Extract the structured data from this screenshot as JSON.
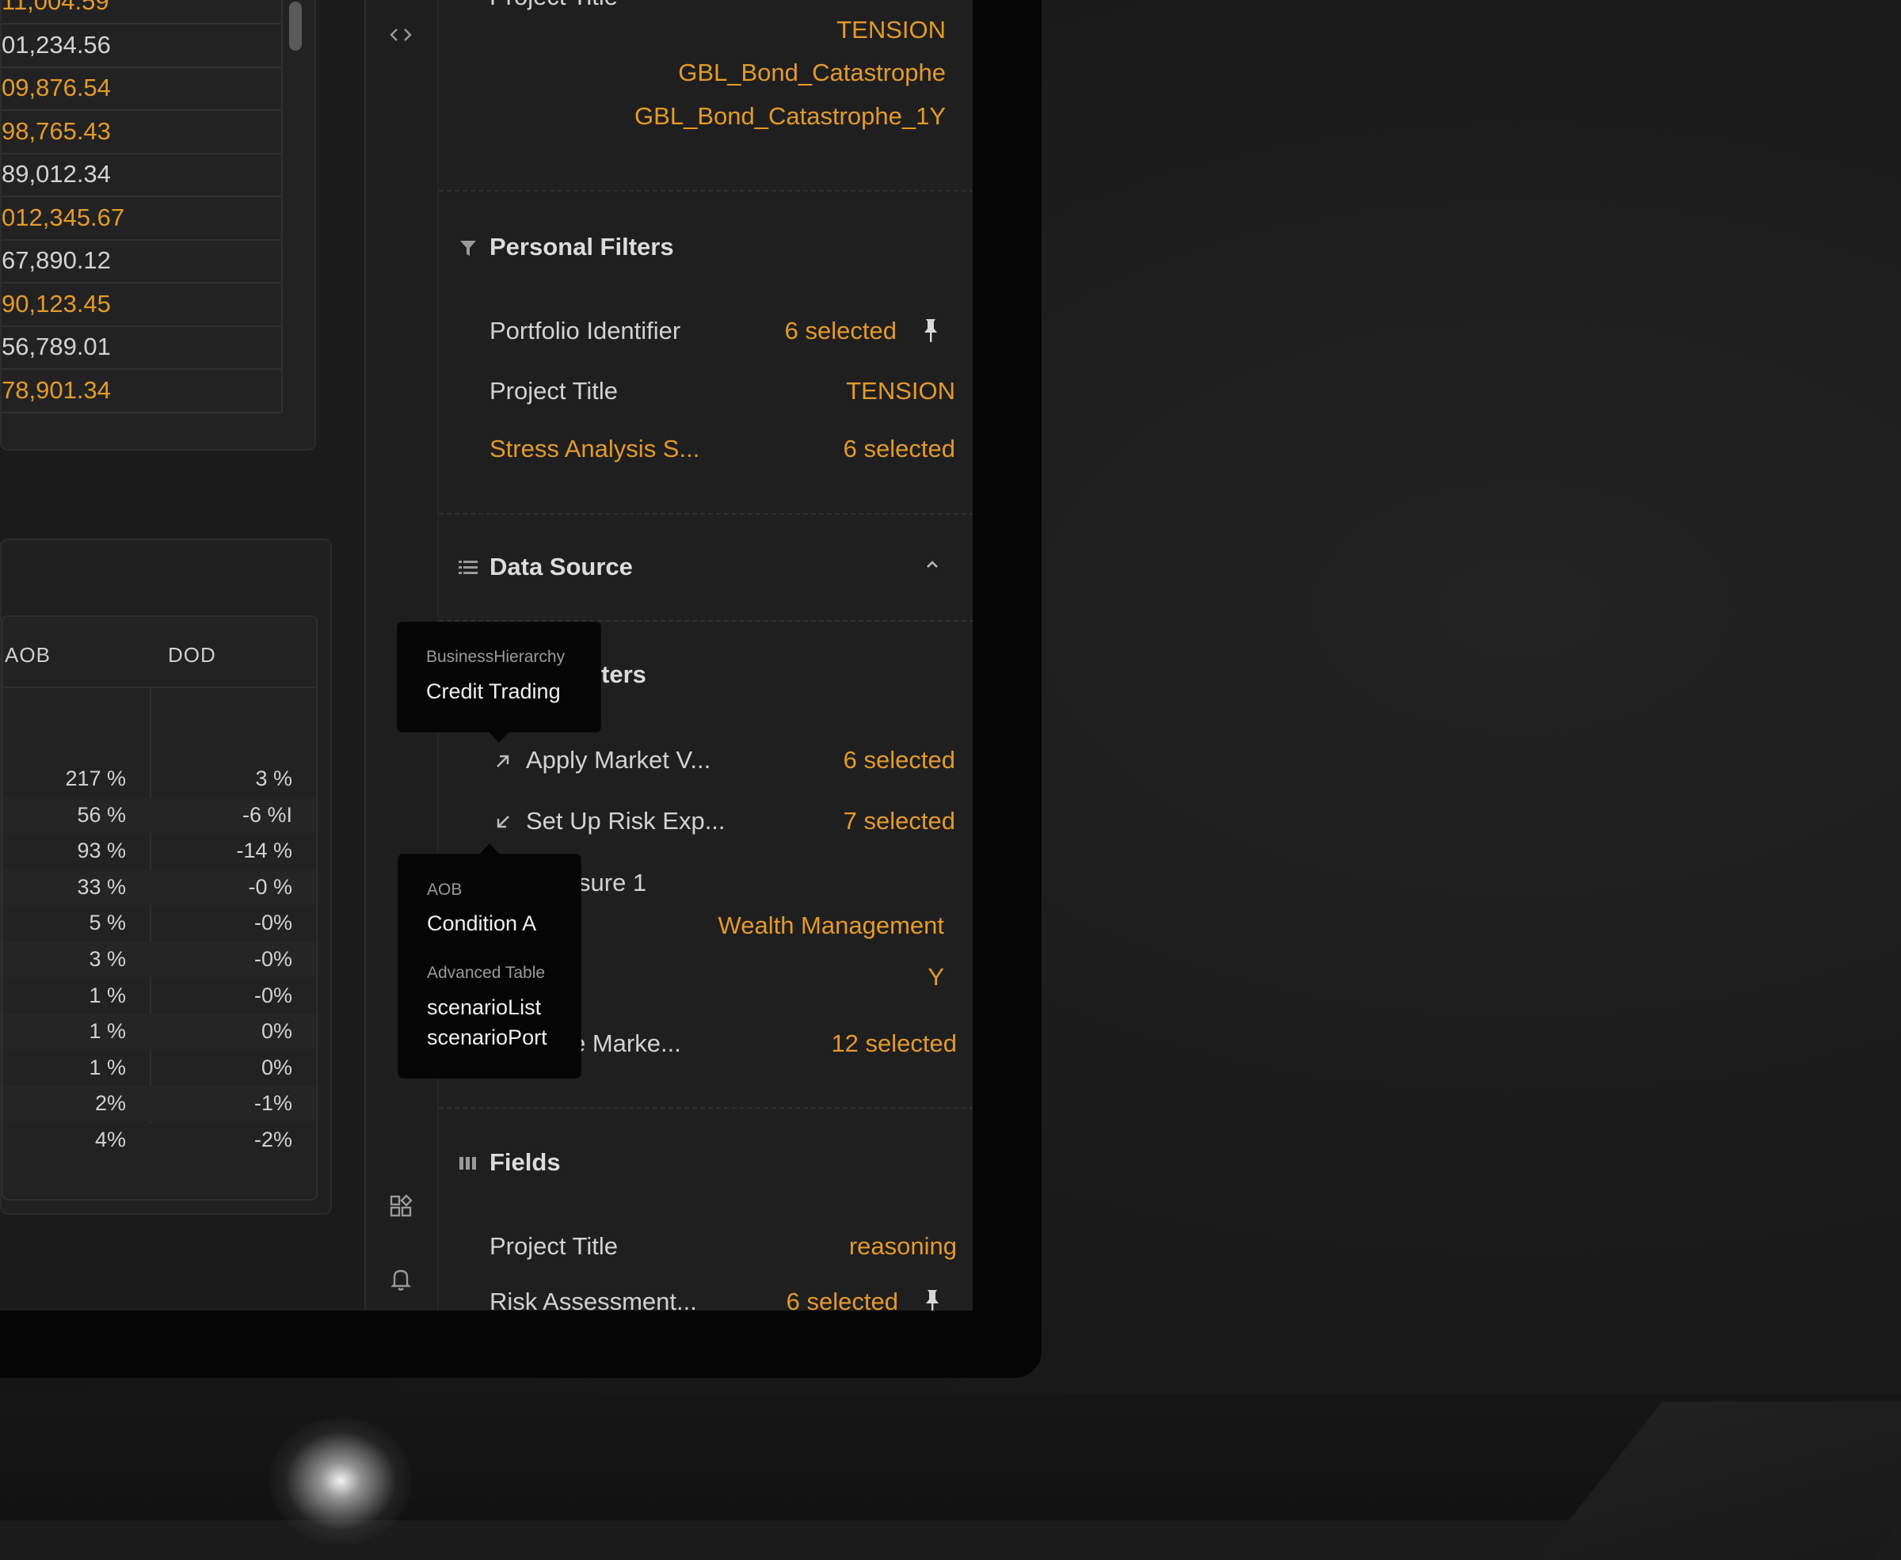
{
  "left_values": [
    {
      "text": "11,004.59",
      "highlight": true
    },
    {
      "text": "01,234.56",
      "highlight": false
    },
    {
      "text": "09,876.54",
      "highlight": true
    },
    {
      "text": "98,765.43",
      "highlight": true
    },
    {
      "text": "89,012.34",
      "highlight": false
    },
    {
      "text": "012,345.67",
      "highlight": true
    },
    {
      "text": "67,890.12",
      "highlight": false
    },
    {
      "text": "90,123.45",
      "highlight": true
    },
    {
      "text": "56,789.01",
      "highlight": false
    },
    {
      "text": "78,901.34",
      "highlight": true
    }
  ],
  "table": {
    "col_aob": "AOB",
    "col_dod": "DOD",
    "rows": [
      {
        "aob": "217 %",
        "dod": "3 %"
      },
      {
        "aob": "56 %",
        "dod": "-6 %I"
      },
      {
        "aob": "93 %",
        "dod": "-14 %"
      },
      {
        "aob": "33 %",
        "dod": "-0 %"
      },
      {
        "aob": "5 %",
        "dod": "-0%"
      },
      {
        "aob": "3 %",
        "dod": "-0%"
      },
      {
        "aob": "1 %",
        "dod": "-0%"
      },
      {
        "aob": "1 %",
        "dod": "0%"
      },
      {
        "aob": "1 %",
        "dod": "0%"
      },
      {
        "aob": "2%",
        "dod": "-1%"
      },
      {
        "aob": "4%",
        "dod": "-2%"
      }
    ]
  },
  "rail": {
    "toggle_icon": "code-brackets-icon",
    "widgets_icon": "widgets-icon",
    "bell_icon": "bell-icon"
  },
  "panel": {
    "cutoff_label": "Project Title",
    "top_values": [
      "TENSION",
      "GBL_Bond_Catastrophe",
      "GBL_Bond_Catastrophe_1Y"
    ],
    "personal_filters": {
      "title": "Personal Filters",
      "portfolio_label": "Portfolio Identifier",
      "portfolio_value": "6 selected",
      "project_label": "Project Title",
      "project_value": "TENSION",
      "stress_label": "Stress Analysis S...",
      "stress_value": "6 selected"
    },
    "data_source": {
      "title": "Data Source",
      "sub_title_tail": "ters",
      "apply_label": "Apply Market V...",
      "apply_value": "6 selected",
      "setup_label": "Set Up Risk Exp...",
      "setup_value": "7 selected",
      "measure_tail": "sure 1",
      "wealth_value": "Wealth Management",
      "y_value": "Y",
      "marke_tail": "e Marke...",
      "marke_value": "12 selected"
    },
    "fields": {
      "title": "Fields",
      "project_label": "Project Title",
      "project_value": "reasoning",
      "risk_label": "Risk Assessment...",
      "risk_value": "6 selected"
    }
  },
  "tooltip1": {
    "label": "BusinessHierarchy",
    "value": "Credit Trading"
  },
  "tooltip2": {
    "label1": "AOB",
    "value1": "Condition A",
    "label2": "Advanced Table",
    "value2a": "scenarioList",
    "value2b": "scenarioPort"
  },
  "colors": {
    "accent": "#e39a2a",
    "text": "#d2d2d2",
    "panel_bg": "#1f1f1f"
  }
}
